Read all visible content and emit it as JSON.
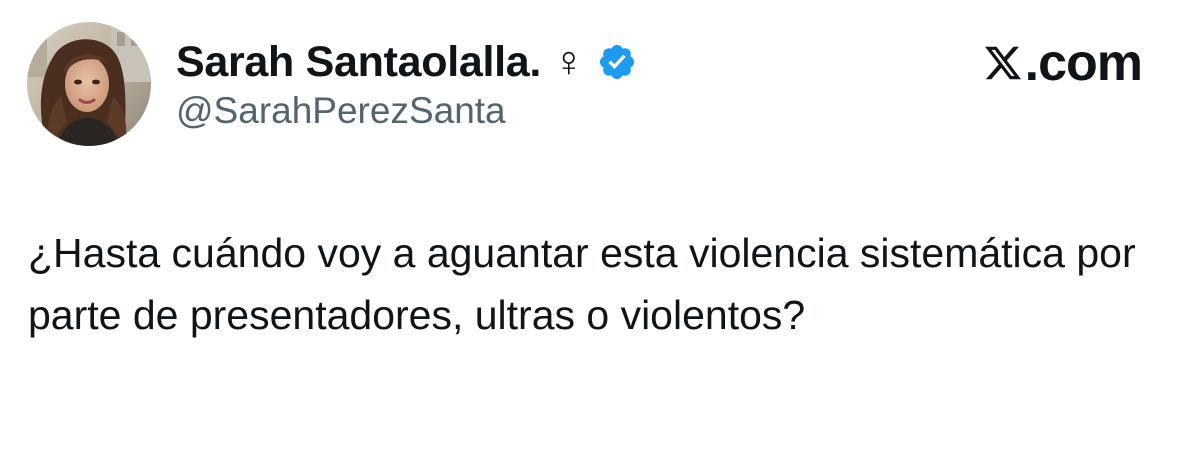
{
  "tweet": {
    "author": {
      "display_name": "Sarah Santaolalla. ♀",
      "handle": "@SarahPerezSanta",
      "verified": true,
      "avatar_icon": "profile-photo"
    },
    "text": "¿Hasta cuándo voy a aguantar esta violencia sistemática por parte de presentadores, ultras o violentos?"
  },
  "brand": {
    "label": ".com",
    "icon": "x-logo-icon"
  },
  "colors": {
    "verified_blue": "#1d9bf0",
    "handle_gray": "#536471",
    "text_black": "#0f1419"
  }
}
